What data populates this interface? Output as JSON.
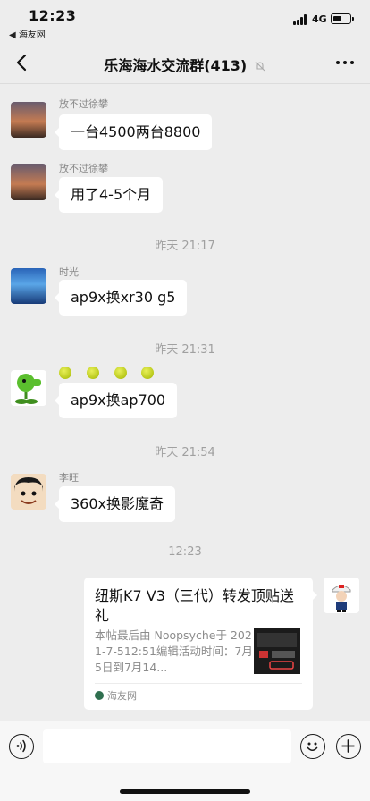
{
  "status": {
    "time": "12:23",
    "back_app": "◀ 海友网",
    "network": "4G"
  },
  "nav": {
    "title": "乐海海水交流群(413)"
  },
  "messages": [
    {
      "sender": "放不过徐攀",
      "text": "一台4500两台8800"
    },
    {
      "sender": "放不过徐攀",
      "text": "用了4-5个月"
    },
    {
      "timestamp": "昨天 21:17"
    },
    {
      "sender": "时光",
      "text": "ap9x换xr30 g5"
    },
    {
      "timestamp": "昨天 21:31"
    },
    {
      "sender": "",
      "text": "ap9x换ap700"
    },
    {
      "timestamp": "昨天 21:54"
    },
    {
      "sender": "李旺",
      "text": "360x换影魔奇"
    },
    {
      "timestamp": "12:23"
    }
  ],
  "card": {
    "title": "纽斯K7 V3（三代）转发顶贴送礼",
    "description": "本帖最后由 Noopsyche于 2021-7-512:51编辑活动时间：7月5日到7月14...",
    "source": "海友网"
  },
  "colors": {
    "background": "#ededed",
    "bubble": "#ffffff",
    "muted_text": "#888888"
  }
}
